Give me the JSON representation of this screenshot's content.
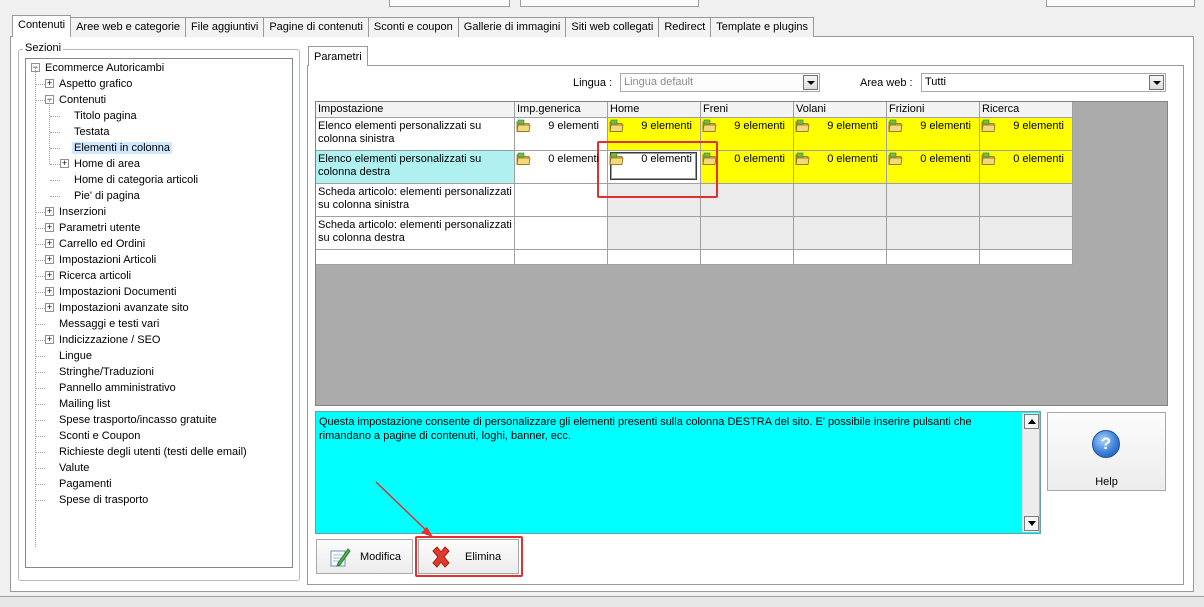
{
  "tabs": [
    "Contenuti",
    "Aree web e categorie",
    "File aggiuntivi",
    "Pagine di contenuti",
    "Sconti e coupon",
    "Gallerie di immagini",
    "Siti web collegati",
    "Redirect",
    "Template e plugins"
  ],
  "sections": {
    "title": "Sezioni",
    "tree": [
      {
        "label": "Ecommerce Autoricambi",
        "level": 0,
        "expander": "minus"
      },
      {
        "label": "Aspetto grafico",
        "level": 1,
        "expander": "plus"
      },
      {
        "label": "Contenuti",
        "level": 1,
        "expander": "minus"
      },
      {
        "label": "Titolo pagina",
        "level": 2,
        "expander": ""
      },
      {
        "label": "Testata",
        "level": 2,
        "expander": ""
      },
      {
        "label": "Elementi in colonna",
        "level": 2,
        "expander": "",
        "selected": true
      },
      {
        "label": "Home di area",
        "level": 2,
        "expander": "plus"
      },
      {
        "label": "Home di categoria articoli",
        "level": 2,
        "expander": ""
      },
      {
        "label": "Pie' di pagina",
        "level": 2,
        "expander": ""
      },
      {
        "label": "Inserzioni",
        "level": 1,
        "expander": "plus"
      },
      {
        "label": "Parametri utente",
        "level": 1,
        "expander": "plus"
      },
      {
        "label": "Carrello ed Ordini",
        "level": 1,
        "expander": "plus"
      },
      {
        "label": "Impostazioni Articoli",
        "level": 1,
        "expander": "plus"
      },
      {
        "label": "Ricerca articoli",
        "level": 1,
        "expander": "plus"
      },
      {
        "label": "Impostazioni Documenti",
        "level": 1,
        "expander": "plus"
      },
      {
        "label": "Impostazioni avanzate sito",
        "level": 1,
        "expander": "plus"
      },
      {
        "label": "Messaggi e testi vari",
        "level": 1,
        "expander": ""
      },
      {
        "label": "Indicizzazione / SEO",
        "level": 1,
        "expander": "plus"
      },
      {
        "label": "Lingue",
        "level": 1,
        "expander": ""
      },
      {
        "label": "Stringhe/Traduzioni",
        "level": 1,
        "expander": ""
      },
      {
        "label": "Pannello amministrativo",
        "level": 1,
        "expander": ""
      },
      {
        "label": "Mailing list",
        "level": 1,
        "expander": ""
      },
      {
        "label": "Spese trasporto/incasso gratuite",
        "level": 1,
        "expander": ""
      },
      {
        "label": "Sconti e Coupon",
        "level": 1,
        "expander": ""
      },
      {
        "label": "Richieste degli utenti (testi delle email)",
        "level": 1,
        "expander": ""
      },
      {
        "label": "Valute",
        "level": 1,
        "expander": ""
      },
      {
        "label": "Pagamenti",
        "level": 1,
        "expander": ""
      },
      {
        "label": "Spese di trasporto",
        "level": 1,
        "expander": ""
      }
    ]
  },
  "params": {
    "tab_label": "Parametri",
    "lingua_label": "Lingua :",
    "lingua_value": "Lingua default",
    "area_label": "Area web :",
    "area_value": "Tutti"
  },
  "grid": {
    "columns": [
      "Impostazione",
      "Imp.generica",
      "Home",
      "Freni",
      "Volani",
      "Frizioni",
      "Ricerca"
    ],
    "rows": [
      {
        "label": "Elenco elementi personalizzati su colonna sinistra",
        "cells": [
          "9 elementi",
          "9 elementi",
          "9 elementi",
          "9 elementi",
          "9 elementi",
          "9 elementi"
        ],
        "style": [
          "plain",
          "yellow",
          "yellow",
          "yellow",
          "yellow",
          "yellow"
        ]
      },
      {
        "label": "Elenco elementi personalizzati su colonna destra",
        "cells": [
          "0 elementi",
          "0 elementi",
          "0 elementi",
          "0 elementi",
          "0 elementi",
          "0 elementi"
        ],
        "style": [
          "plain",
          "editing",
          "yellow",
          "yellow",
          "yellow",
          "yellow"
        ],
        "selected": true
      },
      {
        "label": "Scheda articolo: elementi personalizzati su colonna sinistra",
        "cells": [
          "",
          "",
          "",
          "",
          "",
          ""
        ],
        "style": [
          "plain",
          "empty",
          "empty",
          "empty",
          "empty",
          "empty"
        ]
      },
      {
        "label": "Scheda articolo: elementi personalizzati su colonna destra",
        "cells": [
          "",
          "",
          "",
          "",
          "",
          ""
        ],
        "style": [
          "plain",
          "empty",
          "empty",
          "empty",
          "empty",
          "empty"
        ]
      },
      {
        "label": "",
        "cells": [
          "",
          "",
          "",
          "",
          "",
          ""
        ],
        "style": [
          "plain",
          "plain",
          "plain",
          "plain",
          "plain",
          "plain"
        ]
      }
    ]
  },
  "description": "Questa impostazione consente di personalizzare gli elementi presenti sulla colonna DESTRA del sito. E' possibile inserire pulsanti che rimandano a pagine di contenuti, loghi, banner, ecc.",
  "buttons": {
    "help": "Help",
    "modifica": "Modifica",
    "elimina": "Elimina"
  },
  "colors": {
    "highlight_yellow": "#ffff00",
    "description_bg": "#00ffff",
    "selected_row": "#aff0f0",
    "annotation_red": "#e03030"
  },
  "icons": {
    "folder": "folder-icon",
    "help": "help-icon",
    "modifica": "edit-pencil-icon",
    "elimina": "delete-x-icon"
  }
}
